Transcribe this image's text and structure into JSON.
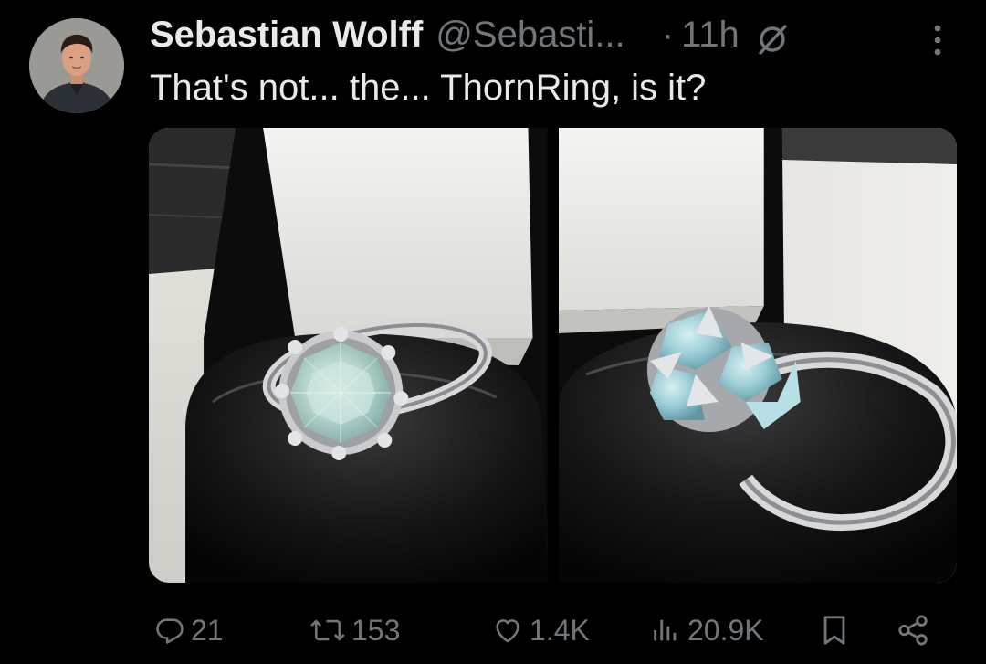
{
  "post": {
    "author": {
      "display_name": "Sebastian Wolff",
      "handle": "@Sebasti...",
      "avatar_icon": "profile-photo"
    },
    "separator": "·",
    "timestamp": "11h",
    "grok_icon": "grok-icon",
    "more_icon": "more-icon",
    "text": "That's not... the... ThornRing, is it?",
    "media": [
      {
        "alt": "Silver ring with pale blue faceted stone in a black ring box, front view",
        "icon": "photo"
      },
      {
        "alt": "Silver ring with pale blue stone in a black ring box, side view",
        "icon": "photo"
      }
    ],
    "actions": {
      "replies": {
        "icon": "reply-icon",
        "count": "21"
      },
      "reposts": {
        "icon": "repost-icon",
        "count": "153"
      },
      "likes": {
        "icon": "like-icon",
        "count": "1.4K"
      },
      "views": {
        "icon": "views-icon",
        "count": "20.9K"
      },
      "bookmark": {
        "icon": "bookmark-icon"
      },
      "share": {
        "icon": "share-icon"
      }
    }
  },
  "colors": {
    "background": "#000000",
    "primary_text": "#e7e9ea",
    "secondary_text": "#71767b"
  }
}
